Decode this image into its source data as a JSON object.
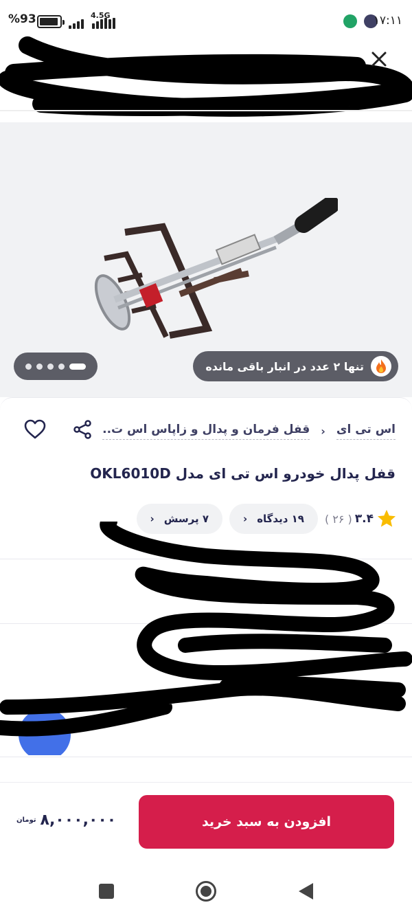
{
  "status_bar": {
    "battery": "93",
    "network": "4.5G",
    "time": "۱۷:۱۱"
  },
  "stock_badge": {
    "text": "تنها ۲ عدد در انبار باقی مانده"
  },
  "breadcrumb": {
    "brand": "اس تی ای",
    "category": "قفل فرمان و پدال و زاپاس اس ت.."
  },
  "product": {
    "title": "قفل پدال خودرو اس تی ای مدل OKL6010D"
  },
  "rating": {
    "score": "۳.۴",
    "count": "( ۲۶ )"
  },
  "pills": {
    "comments": "۱۹ دیدگاه",
    "questions": "۷ پرسش"
  },
  "footer": {
    "add_to_cart": "افزودن به سبد خرید",
    "price": "۸,۰۰۰,۰۰۰",
    "currency": "تومان"
  },
  "colors": {
    "primary": "#d51e4b",
    "text": "#23254e",
    "badge_bg": "#5c5d66"
  }
}
